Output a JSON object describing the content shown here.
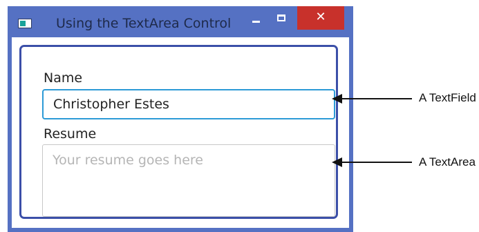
{
  "window": {
    "title": "Using the TextArea Control",
    "controls": {
      "minimize": "minimize",
      "maximize": "maximize",
      "close": "close"
    },
    "colors": {
      "frame": "#5571c3",
      "close": "#c8312b",
      "pane_border": "#3b4fa8",
      "focus": "#2c9ad6"
    }
  },
  "form": {
    "name_label": "Name",
    "name_value": "Christopher Estes",
    "resume_label": "Resume",
    "resume_placeholder": "Your resume goes here",
    "resume_value": ""
  },
  "annotations": {
    "textfield": "A TextField",
    "textarea": "A TextArea"
  }
}
